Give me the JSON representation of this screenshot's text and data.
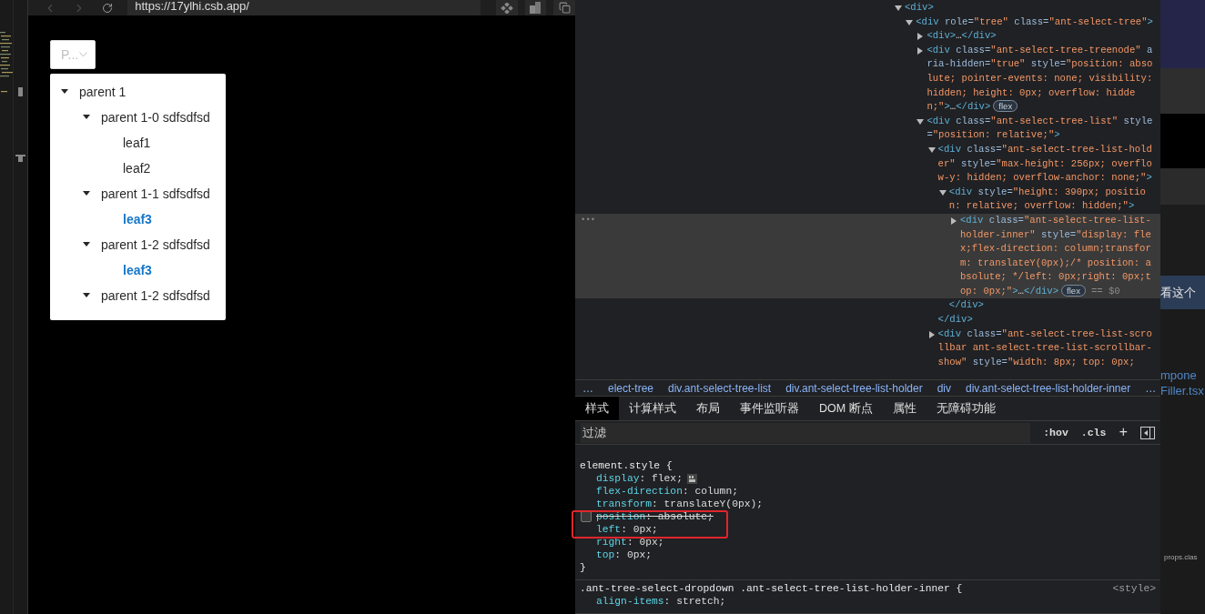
{
  "browser": {
    "nav": [
      {
        "kind": "back",
        "disabled": true
      },
      {
        "kind": "forward",
        "disabled": true
      },
      {
        "kind": "reload",
        "disabled": false
      }
    ],
    "url": "https://17ylhi.csb.app/",
    "tools": [
      {
        "kind": "diamond"
      },
      {
        "kind": "panels"
      },
      {
        "kind": "copy"
      }
    ],
    "select": {
      "text": "P..."
    },
    "tree": [
      {
        "kind": "parent",
        "label": "parent 1",
        "expanded": true,
        "highlighted": false,
        "children": [
          {
            "kind": "parent",
            "label": "parent 1-0 sdfsdfsd",
            "expanded": true,
            "highlighted": false,
            "children": [
              {
                "kind": "leaf",
                "label": "leaf1",
                "highlighted": false
              },
              {
                "kind": "leaf",
                "label": "leaf2",
                "highlighted": false
              }
            ]
          },
          {
            "kind": "parent",
            "label": "parent 1-1 sdfsdfsd",
            "expanded": true,
            "highlighted": false,
            "children": [
              {
                "kind": "leaf",
                "label": "leaf3",
                "highlighted": true
              }
            ]
          },
          {
            "kind": "parent",
            "label": "parent 1-2 sdfsdfsd",
            "expanded": true,
            "highlighted": false,
            "children": [
              {
                "kind": "leaf",
                "label": "leaf3",
                "highlighted": true
              }
            ]
          },
          {
            "kind": "parent",
            "label": "parent 1-2 sdfsdfsd",
            "expanded": true,
            "highlighted": false
          }
        ]
      }
    ]
  },
  "devtools": {
    "dom": [
      {
        "open": "<div>",
        "expanded": true,
        "selected": false,
        "children": [
          {
            "open": "<div role=\"tree\" class=\"ant-select-tree\">",
            "expanded": true,
            "selected": false,
            "children": [
              {
                "open": "<div>…</div>",
                "expanded": false,
                "selected": false
              },
              {
                "open": "<div class=\"ant-select-tree-treenode\" aria-hidden=\"true\" style=\"position: absolute; pointer-events: none; visibility: hidden; height: 0px; overflow: hidden;\">…</div>",
                "expanded": false,
                "selected": false,
                "badge": "flex"
              },
              {
                "open": "<div class=\"ant-select-tree-list\" style=\"position: relative;\">",
                "expanded": true,
                "selected": false,
                "children": [
                  {
                    "open": "<div class=\"ant-select-tree-list-holder\" style=\"max-height: 256px; overflow-y: hidden; overflow-anchor: none;\">",
                    "expanded": true,
                    "selected": false,
                    "close": "</div>",
                    "children": [
                      {
                        "open": "<div style=\"height: 390px; position: relative; overflow: hidden;\">",
                        "expanded": true,
                        "selected": false,
                        "close": "</div>",
                        "children": [
                          {
                            "open": "<div class=\"ant-select-tree-list-holder-inner\" style=\"display: flex;flex-direction: column;transform: translateY(0px);/* position: absolute; */left: 0px;right: 0px;top: 0px;\">…</div>",
                            "expanded": false,
                            "selected": true,
                            "badge": "flex",
                            "marker": "== $0"
                          }
                        ]
                      }
                    ]
                  },
                  {
                    "open": "<div class=\"ant-select-tree-list-scrollbar ant-select-tree-list-scrollbar-show\" style=\"width: 8px; top: 0px;",
                    "expanded": false,
                    "selected": false
                  }
                ]
              }
            ]
          }
        ]
      }
    ],
    "row_menu": "•••",
    "breadcrumbs": [
      "…",
      "elect-tree",
      "div.ant-select-tree-list",
      "div.ant-select-tree-list-holder",
      "div",
      "div.ant-select-tree-list-holder-inner",
      "…"
    ],
    "tabs": [
      {
        "label": "样式",
        "selected": true
      },
      {
        "label": "计算样式",
        "selected": false
      },
      {
        "label": "布局",
        "selected": false
      },
      {
        "label": "事件监听器",
        "selected": false
      },
      {
        "label": "DOM 断点",
        "selected": false
      },
      {
        "label": "属性",
        "selected": false
      },
      {
        "label": "无障碍功能",
        "selected": false
      }
    ],
    "filter": {
      "placeholder": "过滤",
      "hov": ":hov",
      "cls": ".cls",
      "add": "+"
    },
    "rules": [
      {
        "selector": "element.style {",
        "props": [
          {
            "decl": "display: flex;",
            "enabled": true,
            "grid_icon": true
          },
          {
            "decl": "flex-direction: column;",
            "enabled": true
          },
          {
            "decl": "transform: translateY(0px);",
            "enabled": true
          },
          {
            "decl": "position: absolute;",
            "enabled": false
          },
          {
            "decl": "left: 0px;",
            "enabled": true
          },
          {
            "decl": "right: 0px;",
            "enabled": true
          },
          {
            "decl": "top: 0px;",
            "enabled": true
          }
        ],
        "close": "}"
      },
      {
        "selector": ".ant-tree-select-dropdown .ant-select-tree-list-holder-inner {",
        "source": "<style>",
        "props": [
          {
            "decl": "align-items: stretch;",
            "enabled": true
          }
        ]
      }
    ]
  },
  "side_window": {
    "banner": "看这个",
    "link_1": "mpone",
    "link_2": "Filler.tsx",
    "code": "props.clas"
  }
}
